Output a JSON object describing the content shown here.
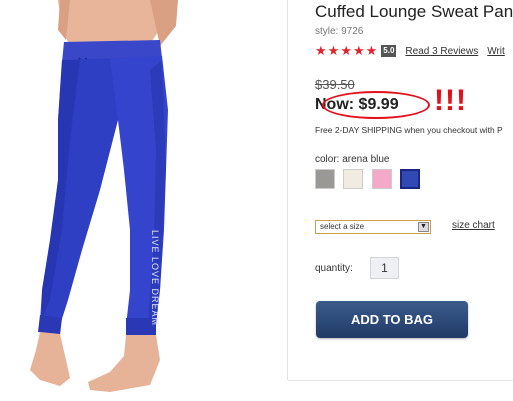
{
  "product": {
    "title": "Cuffed Lounge Sweat Pants",
    "style": "style: 9726",
    "rating_value": "5.0",
    "reviews_link": "Read 3 Reviews",
    "write_link": "Writ",
    "old_price": "$39.50",
    "now_price": "Now: $9.99",
    "annotation": "!!!",
    "shipping": "Free 2-DAY SHIPPING when you checkout with P",
    "color_label": "color: arena blue",
    "size_placeholder": "select a size",
    "size_chart": "size chart",
    "quantity_label": "quantity:",
    "quantity_value": "1",
    "add_to_bag": "ADD TO BAG",
    "image_text": "LIVE LOVE DREAM"
  },
  "swatches": [
    {
      "name": "grey",
      "color": "#9a9996"
    },
    {
      "name": "cream",
      "color": "#f1ece1"
    },
    {
      "name": "pink",
      "color": "#f5a9c9"
    },
    {
      "name": "arena blue",
      "color": "#3248b5"
    }
  ],
  "colors": {
    "accent_red": "#e4101c",
    "star_red": "#e2232e",
    "button_blue": "#213a66",
    "pants_blue": "#2f3fc4"
  },
  "icons": {
    "star": "star-icon",
    "dropdown": "chevron-down-icon"
  }
}
